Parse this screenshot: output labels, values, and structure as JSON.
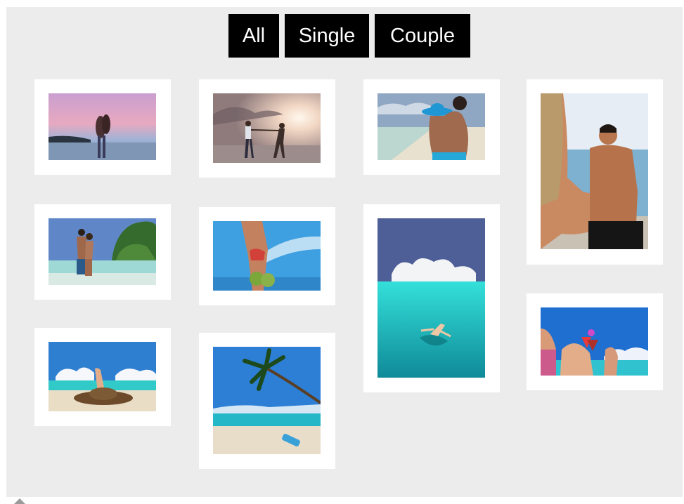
{
  "filters": {
    "all_label": "All",
    "single_label": "Single",
    "couple_label": "Couple"
  },
  "gallery": {
    "photos": [
      {
        "name": "couple-embrace-sunset-beach"
      },
      {
        "name": "couple-dancing-sunset-beach"
      },
      {
        "name": "couple-sunhat-beach"
      },
      {
        "name": "man-reaching-hand-beach"
      },
      {
        "name": "couple-kissing-lagoon"
      },
      {
        "name": "woman-coconuts-beach"
      },
      {
        "name": "swimmer-turquoise-lagoon"
      },
      {
        "name": "woman-sunhat-lying-sand"
      },
      {
        "name": "palm-tree-beach"
      },
      {
        "name": "cocktail-toast-beach"
      }
    ]
  },
  "colors": {
    "page_background": "#ececec",
    "card_background": "#ffffff",
    "filter_button_bg": "#000000",
    "filter_button_text": "#ffffff"
  }
}
